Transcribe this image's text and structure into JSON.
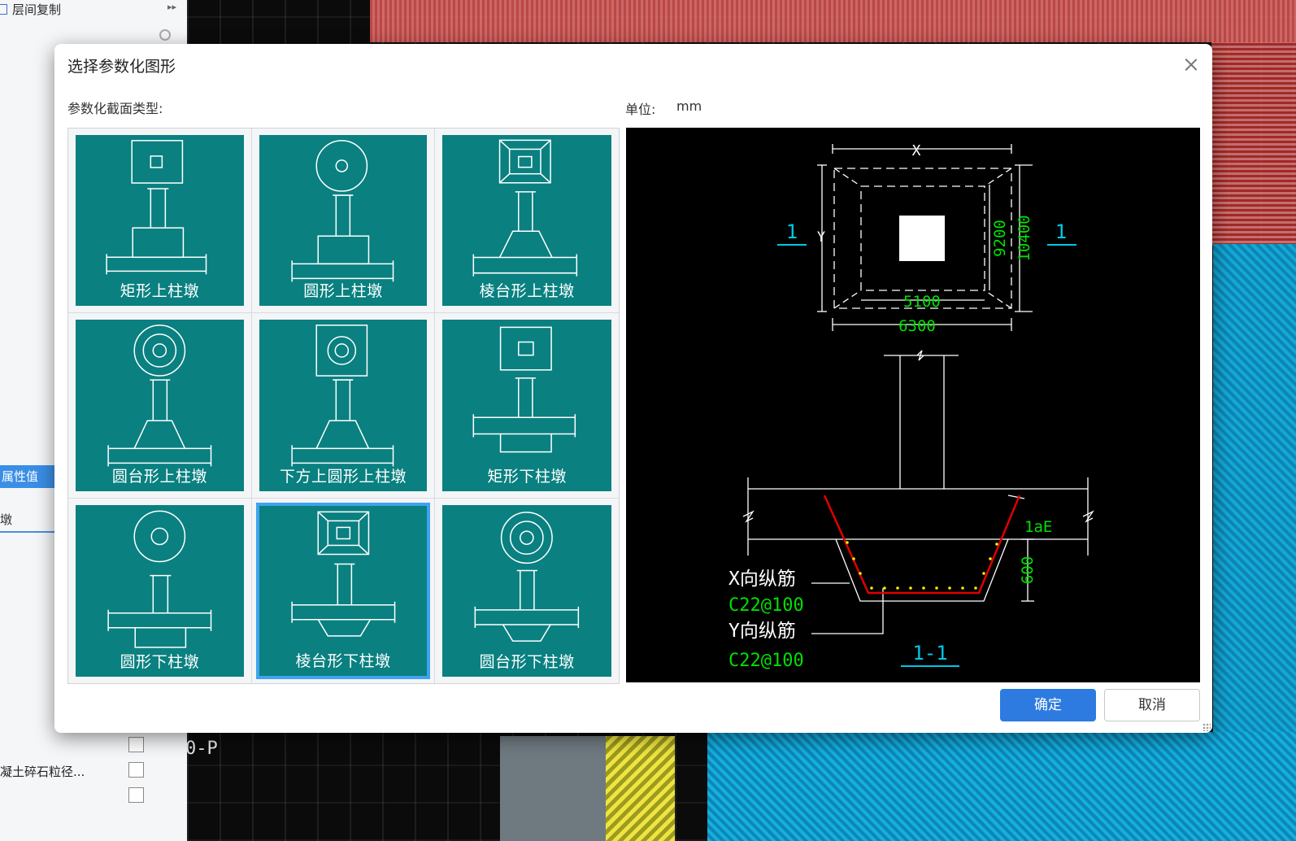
{
  "left_panel": {
    "top_item": "层间复制",
    "property_header": "属性值",
    "row_1": "墩",
    "row_2": "凝土碎石粒径..."
  },
  "background": {
    "cad_label": "0-P"
  },
  "dialog": {
    "title": "选择参数化图形",
    "section_type_label": "参数化截面类型:",
    "unit_label": "单位:",
    "unit_value": "mm",
    "shapes": [
      {
        "label": "矩形上柱墩",
        "icon": "rect-upper-pier-icon",
        "selected": false
      },
      {
        "label": "圆形上柱墩",
        "icon": "circle-upper-pier-icon",
        "selected": false
      },
      {
        "label": "棱台形上柱墩",
        "icon": "frustum-upper-pier-icon",
        "selected": false
      },
      {
        "label": "圆台形上柱墩",
        "icon": "round-frustum-upper-pier-icon",
        "selected": false
      },
      {
        "label": "下方上圆形上柱墩",
        "icon": "square-round-upper-pier-icon",
        "selected": false
      },
      {
        "label": "矩形下柱墩",
        "icon": "rect-lower-pier-icon",
        "selected": false
      },
      {
        "label": "圆形下柱墩",
        "icon": "circle-lower-pier-icon",
        "selected": false
      },
      {
        "label": "棱台形下柱墩",
        "icon": "frustum-lower-pier-icon",
        "selected": true
      },
      {
        "label": "圆台形下柱墩",
        "icon": "round-frustum-lower-pier-icon",
        "selected": false
      }
    ],
    "preview": {
      "dim_x": "X",
      "dim_y": "Y",
      "dim_5100": "5100",
      "dim_6300": "6300",
      "dim_9200": "9200",
      "dim_10400": "10400",
      "section_mark_left": "1",
      "section_mark_right": "1",
      "lae_label": "1aE",
      "depth_600": "600",
      "x_rebar_label": "X向纵筋",
      "x_rebar_value": "C22@100",
      "y_rebar_label": "Y向纵筋",
      "y_rebar_value": "C22@100",
      "section_name": "1-1",
      "colors": {
        "green": "#00e000",
        "cyan": "#00c8e8",
        "red": "#e00000",
        "yellow": "#f0f000"
      }
    },
    "ok_label": "确定",
    "cancel_label": "取消"
  }
}
